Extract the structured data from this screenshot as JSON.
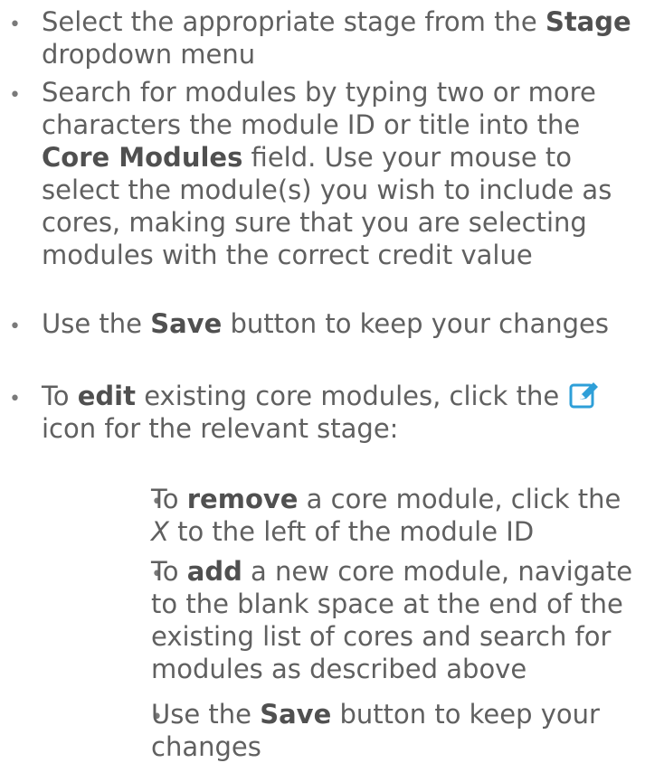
{
  "items": [
    {
      "pre": "Select the appropriate stage from the ",
      "bold": "Stage",
      "post": " dropdown menu"
    },
    {
      "pre": "Search for modules by typing two or more characters the module ID or title into the ",
      "bold": "Core Modules",
      "post": " field. Use your mouse to select the module(s) you wish to include as cores, making sure that you are selecting modules with the correct credit value"
    },
    {
      "pre": "Use the ",
      "bold": "Save",
      "post": " button to keep your changes"
    },
    {
      "pre": "To ",
      "bold": "edit",
      "post": " existing core modules, click the",
      "post2": " icon for the relevant stage:"
    }
  ],
  "subitems": [
    {
      "pre": "To ",
      "bold": "remove",
      "post": " a core module, click the ",
      "italic": "X",
      "post2": " to the left of the module ID"
    },
    {
      "pre": "To ",
      "bold": "add",
      "post": " a new core module, navigate to the blank space at the end of the existing list of cores and search for modules as described above"
    },
    {
      "pre": "Use the ",
      "bold": "Save",
      "post": " button to keep your changes"
    }
  ],
  "bullet_glyph": "•",
  "icon": "edit-pencil-icon",
  "colors": {
    "text": "#606060",
    "icon": "#2e9fd8"
  }
}
